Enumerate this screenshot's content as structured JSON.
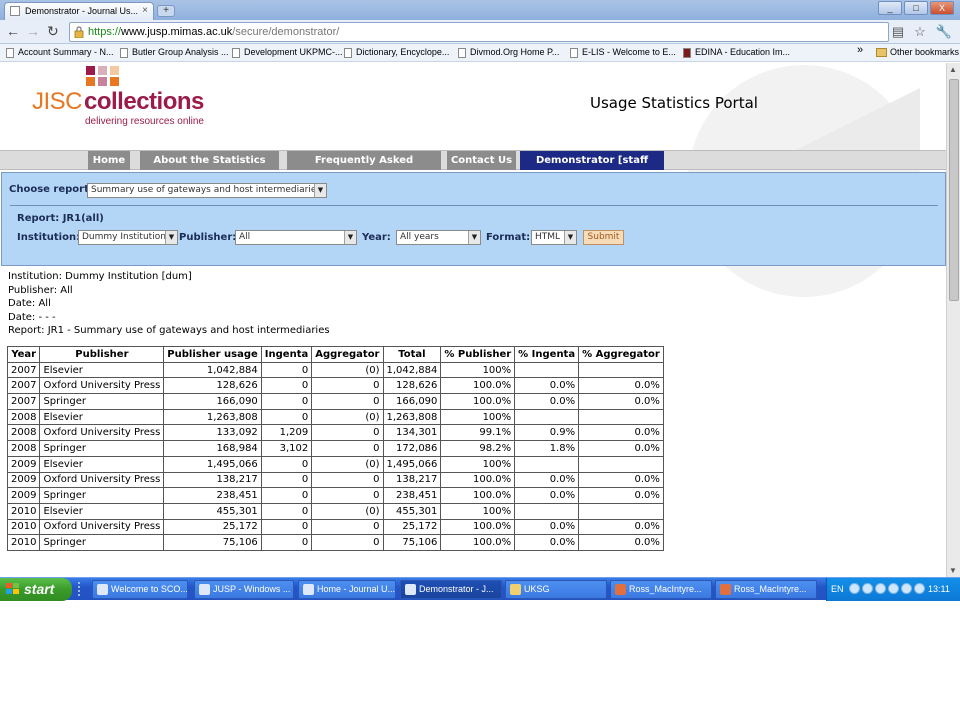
{
  "browser": {
    "tab_title": "Demonstrator - Journal Us...",
    "new_tab_symbol": "+",
    "url_scheme": "https://",
    "url_host": "www.jusp.mimas.ac.uk",
    "url_path": "/secure/demonstrator/",
    "bookmarks": [
      "Account Summary - N...",
      "Butler Group Analysis ...",
      "Development UKPMC-...",
      "Dictionary, Encyclope...",
      "Divmod.Org  Home  P...",
      "E-LIS - Welcome to E...",
      "EDINA - Education Im..."
    ],
    "bookmarks_more": "»",
    "other_bookmarks": "Other bookmarks",
    "window_buttons": [
      "_",
      "□",
      "X"
    ]
  },
  "site": {
    "logo_brand": "JISC",
    "logo_name": "collections",
    "logo_tagline": "delivering resources online",
    "portal_title": "Usage Statistics Portal",
    "menu": [
      {
        "label": "Home"
      },
      {
        "label": "About the Statistics Portal"
      },
      {
        "label": "Frequently Asked Questions"
      },
      {
        "label": "Contact Us"
      },
      {
        "label": "Demonstrator [staff only]",
        "active": true
      }
    ]
  },
  "filters": {
    "choose_report_label": "Choose report:",
    "choose_report_value": "Summary use of gateways and host intermediaries",
    "report_label": "Report:  JR1(all)",
    "institution_label": "Institution:",
    "institution_value": "Dummy Institution",
    "publisher_label": "Publisher:",
    "publisher_value": "All",
    "year_label": "Year:",
    "year_value": "All years",
    "format_label": "Format:",
    "format_value": "HTML",
    "submit_label": "Submit"
  },
  "report_meta": [
    "Institution: Dummy Institution [dum]",
    "Publisher: All",
    "Date: All",
    "Date: - - -",
    "Report: JR1 - Summary use of gateways and host intermediaries"
  ],
  "table": {
    "headers": [
      "Year",
      "Publisher",
      "Publisher usage",
      "Ingenta",
      "Aggregator",
      "Total",
      "% Publisher",
      "% Ingenta",
      "% Aggregator"
    ],
    "rows": [
      [
        "2007",
        "Elsevier",
        "1,042,884",
        "0",
        "(0)",
        "1,042,884",
        "100%",
        "",
        ""
      ],
      [
        "2007",
        "Oxford University Press",
        "128,626",
        "0",
        "0",
        "128,626",
        "100.0%",
        "0.0%",
        "0.0%"
      ],
      [
        "2007",
        "Springer",
        "166,090",
        "0",
        "0",
        "166,090",
        "100.0%",
        "0.0%",
        "0.0%"
      ],
      [
        "2008",
        "Elsevier",
        "1,263,808",
        "0",
        "(0)",
        "1,263,808",
        "100%",
        "",
        ""
      ],
      [
        "2008",
        "Oxford University Press",
        "133,092",
        "1,209",
        "0",
        "134,301",
        "99.1%",
        "0.9%",
        "0.0%"
      ],
      [
        "2008",
        "Springer",
        "168,984",
        "3,102",
        "0",
        "172,086",
        "98.2%",
        "1.8%",
        "0.0%"
      ],
      [
        "2009",
        "Elsevier",
        "1,495,066",
        "0",
        "(0)",
        "1,495,066",
        "100%",
        "",
        ""
      ],
      [
        "2009",
        "Oxford University Press",
        "138,217",
        "0",
        "0",
        "138,217",
        "100.0%",
        "0.0%",
        "0.0%"
      ],
      [
        "2009",
        "Springer",
        "238,451",
        "0",
        "0",
        "238,451",
        "100.0%",
        "0.0%",
        "0.0%"
      ],
      [
        "2010",
        "Elsevier",
        "455,301",
        "0",
        "(0)",
        "455,301",
        "100%",
        "",
        ""
      ],
      [
        "2010",
        "Oxford University Press",
        "25,172",
        "0",
        "0",
        "25,172",
        "100.0%",
        "0.0%",
        "0.0%"
      ],
      [
        "2010",
        "Springer",
        "75,106",
        "0",
        "0",
        "75,106",
        "100.0%",
        "0.0%",
        "0.0%"
      ]
    ]
  },
  "taskbar": {
    "start_label": "start",
    "tasks": [
      {
        "label": "Welcome to SCO..."
      },
      {
        "label": "JUSP - Windows ..."
      },
      {
        "label": "Home - Journal U..."
      },
      {
        "label": "Demonstrator - J...",
        "active": true
      },
      {
        "label": "UKSG"
      },
      {
        "label": "Ross_MacIntyre..."
      },
      {
        "label": "Ross_MacIntyre..."
      }
    ],
    "language": "EN",
    "clock": "13:11"
  },
  "colors": {
    "jisc_orange": "#e87722",
    "collections_maroon": "#9b1b4a",
    "menu_active": "#1c2a86",
    "filter_panel": "#b3d5f6"
  }
}
